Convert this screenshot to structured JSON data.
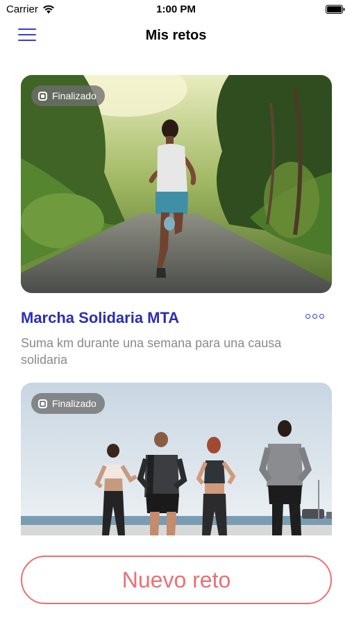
{
  "status_bar": {
    "carrier": "Carrier",
    "time": "1:00 PM"
  },
  "nav": {
    "title": "Mis retos",
    "menu_icon": "hamburger-menu-icon"
  },
  "challenges": [
    {
      "badge": "Finalizado",
      "title": "Marcha Solidaria MTA",
      "description": "Suma km durante una semana para una causa solidaria"
    },
    {
      "badge": "Finalizado"
    }
  ],
  "actions": {
    "new_challenge_label": "Nuevo reto"
  },
  "colors": {
    "accent": "#3b3bd4",
    "title": "#2d2db3",
    "cta": "#ec6f74",
    "badge_bg": "#6e6e6e"
  }
}
